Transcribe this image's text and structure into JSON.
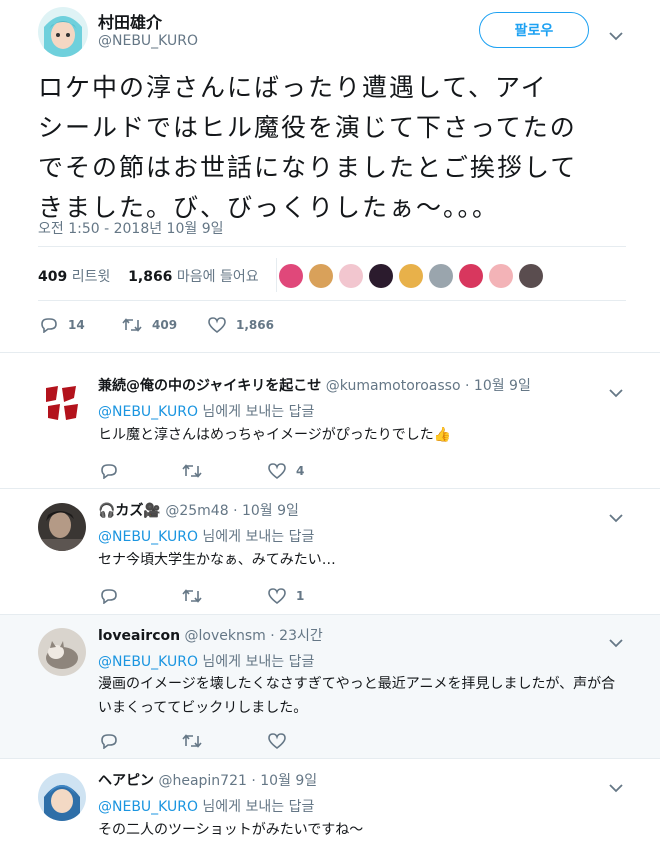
{
  "main_tweet": {
    "author_name": "村田雄介",
    "author_handle": "@NEBU_KURO",
    "follow_label": "팔로우",
    "text_lines": [
      "ロケ中の淳さんにばったり遭遇して、アイ",
      "シールドではヒル魔役を演じて下さってたの",
      "でその節はお世話になりましたとご挨拶して",
      "きました。び、びっくりしたぁ〜。。。"
    ],
    "timestamp": "오전 1:50 - 2018년 10월 9일",
    "retweet_count": "409",
    "retweet_label": "리트윗",
    "like_count": "1,866",
    "like_label": "마음에 들어요",
    "actions": {
      "replies": "14",
      "retweets": "409",
      "likes": "1,866"
    },
    "liker_colors": [
      "#e0487a",
      "#d9a15a",
      "#f2c6cf",
      "#2b1b2d",
      "#e8b14a",
      "#9aa5ad",
      "#d8375e",
      "#f3b3b7",
      "#5a4d4f"
    ]
  },
  "replies": [
    {
      "name": "兼続@俺の中のジャイキリを起こせ",
      "handle": "@kumamotoroasso",
      "time": "10월 9일",
      "to_handle": "@NEBU_KURO",
      "to_suffix": "님에게 보내는 답글",
      "text": "ヒル魔と淳さんはめっちゃイメージがぴったりでした👍",
      "replies": "",
      "retweets": "",
      "likes": "4"
    },
    {
      "name": "🎧カズ🎥",
      "handle": "@25m48",
      "time": "10월 9일",
      "to_handle": "@NEBU_KURO",
      "to_suffix": "님에게 보내는 답글",
      "text": "セナ今頃大学生かなぁ、みてみたい…",
      "replies": "",
      "retweets": "",
      "likes": "1"
    },
    {
      "name": "loveaircon",
      "handle": "@loveknsm",
      "time": "23시간",
      "to_handle": "@NEBU_KURO",
      "to_suffix": "님에게 보내는 답글",
      "text": "漫画のイメージを壊したくなさすぎてやっと最近アニメを拝見しましたが、声が合いまくっててビックリしました。",
      "replies": "",
      "retweets": "",
      "likes": ""
    },
    {
      "name": "ヘアピン",
      "handle": "@heapin721",
      "time": "10월 9일",
      "to_handle": "@NEBU_KURO",
      "to_suffix": "님에게 보내는 답글",
      "text": "その二人のツーショットがみたいですね～"
    }
  ],
  "colors": {
    "accent": "#1da1f2",
    "link": "#1b95e0",
    "muted": "#657786",
    "highlight_bg": "#f5f8fa"
  },
  "icons": [
    "chevron-down-icon",
    "reply-icon",
    "retweet-icon",
    "heart-icon"
  ]
}
